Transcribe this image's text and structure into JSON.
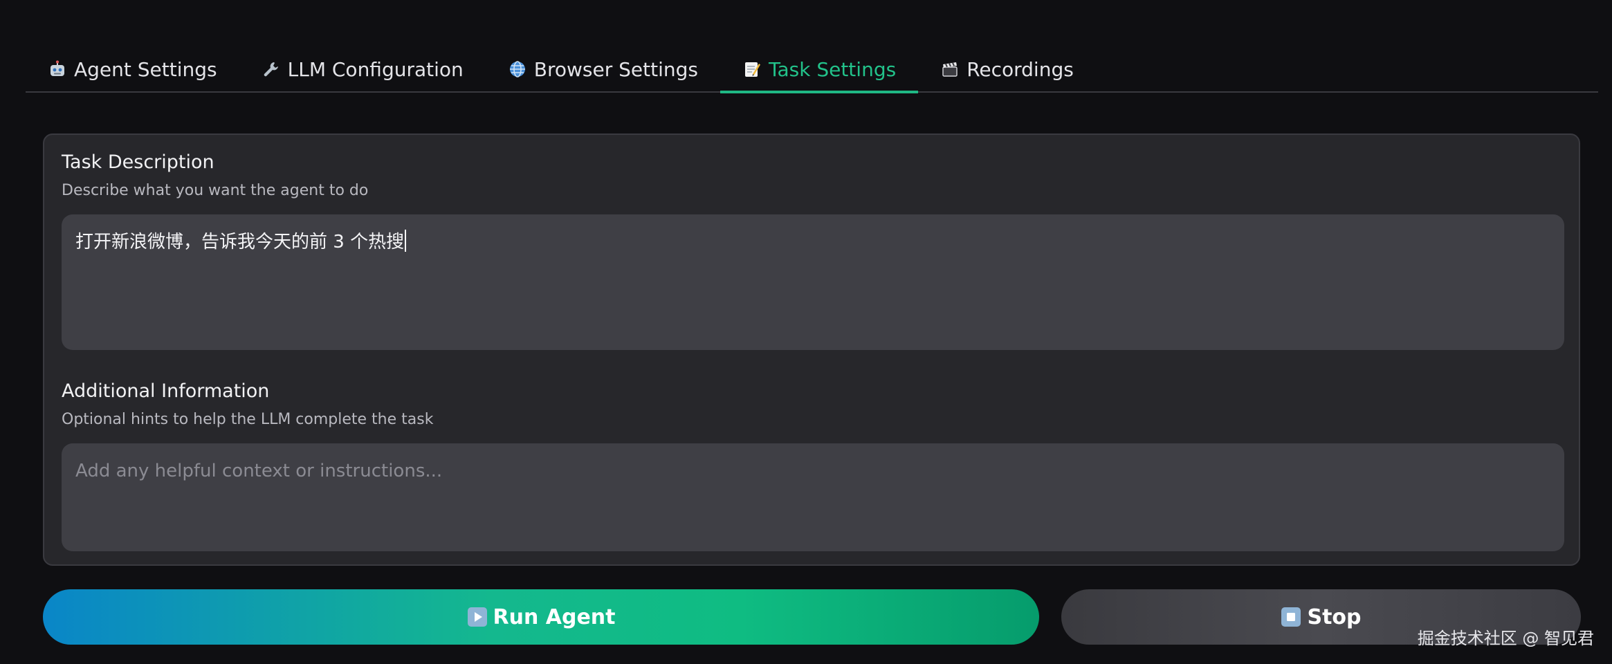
{
  "tabs": [
    {
      "label": "Agent Settings",
      "icon": "robot-icon"
    },
    {
      "label": "LLM Configuration",
      "icon": "wrench-icon"
    },
    {
      "label": "Browser Settings",
      "icon": "globe-icon"
    },
    {
      "label": "Task Settings",
      "icon": "memo-icon",
      "active": true
    },
    {
      "label": "Recordings",
      "icon": "clapper-icon"
    }
  ],
  "task": {
    "label": "Task Description",
    "info": "Describe what you want the agent to do",
    "value": "打开新浪微博，告诉我今天的前 3 个热搜"
  },
  "additional": {
    "label": "Additional Information",
    "info": "Optional hints to help the LLM complete the task",
    "placeholder": "Add any helpful context or instructions..."
  },
  "buttons": {
    "run_label": "Run Agent",
    "stop_label": "Stop"
  },
  "colors": {
    "accent": "#22c28a",
    "run_gradient_start": "#0a86c8",
    "run_gradient_end": "#069c6c"
  },
  "watermark": "掘金技术社区 @ 智见君"
}
